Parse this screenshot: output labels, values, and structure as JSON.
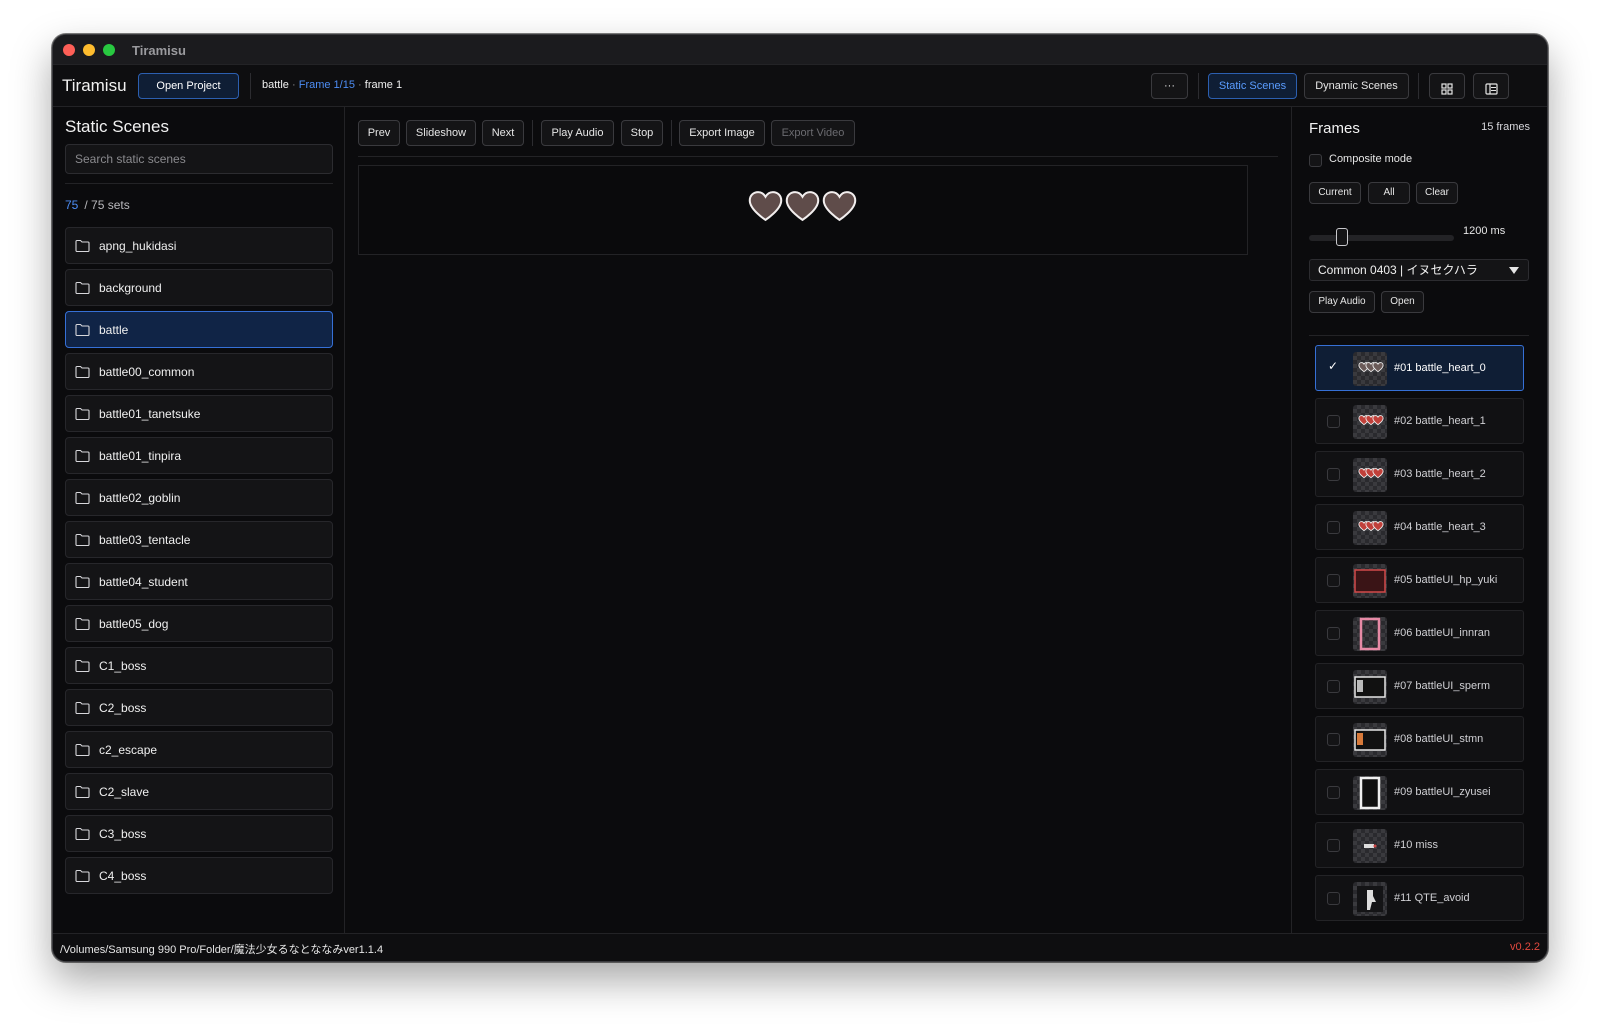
{
  "window": {
    "title": "Tiramisu"
  },
  "toolbar": {
    "app_name": "Tiramisu",
    "open_project_label": "Open Project",
    "breadcrumb": {
      "scene": "battle",
      "frame_index": "Frame 1/15",
      "frame_name": "frame 1",
      "separator": "·"
    },
    "more_label": "···",
    "static_scenes_label": "Static Scenes",
    "dynamic_scenes_label": "Dynamic Scenes",
    "grid_icon": "grid-icon",
    "layout_icon": "layout-panels-icon"
  },
  "sidebar": {
    "title": "Static Scenes",
    "search_placeholder": "Search static scenes",
    "count_filtered": "75",
    "count_total": "/ 75 sets",
    "folder_icon": "folder-icon",
    "items": [
      {
        "label": "apng_hukidasi"
      },
      {
        "label": "background"
      },
      {
        "label": "battle",
        "selected": true
      },
      {
        "label": "battle00_common"
      },
      {
        "label": "battle01_tanetsuke"
      },
      {
        "label": "battle01_tinpira"
      },
      {
        "label": "battle02_goblin"
      },
      {
        "label": "battle03_tentacle"
      },
      {
        "label": "battle04_student"
      },
      {
        "label": "battle05_dog"
      },
      {
        "label": "C1_boss"
      },
      {
        "label": "C2_boss"
      },
      {
        "label": "c2_escape"
      },
      {
        "label": "C2_slave"
      },
      {
        "label": "C3_boss"
      },
      {
        "label": "C4_boss"
      }
    ]
  },
  "controls": {
    "prev": "Prev",
    "slideshow": "Slideshow",
    "next": "Next",
    "play_audio": "Play Audio",
    "stop": "Stop",
    "export_image": "Export Image",
    "export_video": "Export Video"
  },
  "preview": {
    "content": "battle_heart_0",
    "hearts_count": 3,
    "heart_color": "#5f4c4a"
  },
  "frames_panel": {
    "title": "Frames",
    "count": "15 frames",
    "composite_label": "Composite mode",
    "composite_checked": false,
    "current_label": "Current",
    "all_label": "All",
    "clear_label": "Clear",
    "duration_label": "1200 ms",
    "duration_value": 0.2,
    "audio_select": "Common 0403 | イヌセクハラ",
    "play_audio_label": "Play Audio",
    "open_label": "Open",
    "items": [
      {
        "label": "#01 battle_heart_0",
        "checked": true,
        "thumb": "hearts-gray"
      },
      {
        "label": "#02 battle_heart_1",
        "checked": false,
        "thumb": "hearts-red"
      },
      {
        "label": "#03 battle_heart_2",
        "checked": false,
        "thumb": "hearts-red"
      },
      {
        "label": "#04 battle_heart_3",
        "checked": false,
        "thumb": "hearts-red"
      },
      {
        "label": "#05 battleUI_hp_yuki",
        "checked": false,
        "thumb": "hp-frame"
      },
      {
        "label": "#06 battleUI_innran",
        "checked": false,
        "thumb": "pink-frame"
      },
      {
        "label": "#07 battleUI_sperm",
        "checked": false,
        "thumb": "ui-box"
      },
      {
        "label": "#08 battleUI_stmn",
        "checked": false,
        "thumb": "ui-box-orange"
      },
      {
        "label": "#09 battleUI_zyusei",
        "checked": false,
        "thumb": "white-frame"
      },
      {
        "label": "#10 miss",
        "checked": false,
        "thumb": "miss"
      },
      {
        "label": "#11 QTE_avoid",
        "checked": false,
        "thumb": "qte"
      }
    ]
  },
  "statusbar": {
    "path": "/Volumes/Samsung 990 Pro/Folder/魔法少女るなとななみver1.1.4",
    "version": "v0.2.2"
  },
  "colors": {
    "accent": "#3670d6",
    "accent_text": "#4d8df5",
    "version_red": "#e0483e",
    "window_bg": "#0b0b0d"
  }
}
